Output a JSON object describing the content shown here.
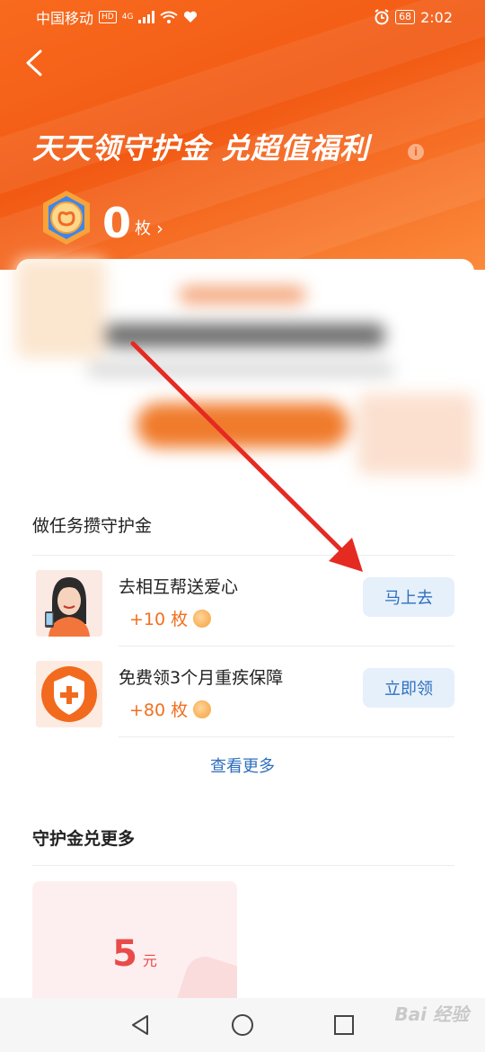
{
  "status_bar": {
    "carrier": "中国移动",
    "hd": "HD",
    "network": "4G",
    "battery": "68",
    "time": "2:02"
  },
  "header": {
    "title": "天天领守护金 兑超值福利",
    "info_glyph": "i",
    "coin_count": "0",
    "coin_unit": "枚",
    "chevron": "›"
  },
  "tasks": {
    "section_title": "做任务攒守护金",
    "items": [
      {
        "name": "去相互帮送爱心",
        "reward": "+10 枚",
        "button": "马上去"
      },
      {
        "name": "免费领3个月重疾保障",
        "reward": "+80 枚",
        "button": "立即领"
      }
    ],
    "see_more": "查看更多"
  },
  "exchange": {
    "section_title": "守护金兑更多",
    "amount": "5",
    "unit": "元"
  },
  "watermark": "Bai 经验",
  "colors": {
    "header_orange": "#f25a14",
    "accent_blue": "#2f6fbf",
    "reward_orange": "#f0701f",
    "arrow_red": "#e52a22"
  }
}
